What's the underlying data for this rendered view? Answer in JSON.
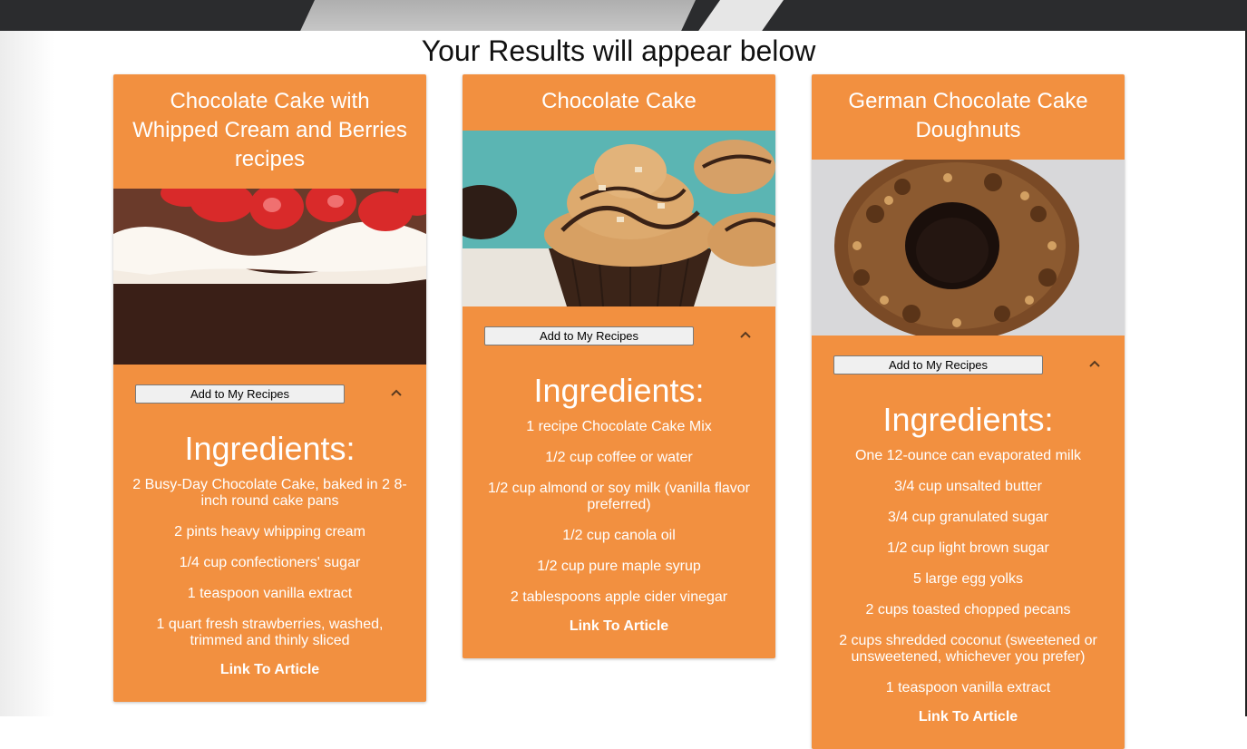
{
  "header": {
    "title": "Your Results will appear below"
  },
  "colors": {
    "card": "#f29040",
    "topbar": "#2b2c2e"
  },
  "cards": [
    {
      "title": "Chocolate Cake with Whipped Cream and Berries recipes",
      "image_alt": "chocolate cake with whipped cream and strawberries",
      "add_label": "Add to My Recipes",
      "ingredients_title": "Ingredients:",
      "ingredients": [
        "2 Busy-Day Chocolate Cake, baked in 2 8-inch round cake pans",
        "2 pints heavy whipping cream",
        "1/4 cup confectioners' sugar",
        "1 teaspoon vanilla extract",
        "1 quart fresh strawberries, washed, trimmed and thinly sliced"
      ],
      "link_label": "Link To Article"
    },
    {
      "title": "Chocolate Cake",
      "image_alt": "chocolate cupcakes with peanut butter frosting",
      "add_label": "Add to My Recipes",
      "ingredients_title": "Ingredients:",
      "ingredients": [
        "1 recipe Chocolate Cake Mix",
        "1/2 cup coffee or water",
        "1/2 cup almond or soy milk (vanilla flavor preferred)",
        "1/2 cup canola oil",
        "1/2 cup pure maple syrup",
        "2 tablespoons apple cider vinegar"
      ],
      "link_label": "Link To Article"
    },
    {
      "title": "German Chocolate Cake Doughnuts",
      "image_alt": "german chocolate doughnut with coconut pecan topping",
      "add_label": "Add to My Recipes",
      "ingredients_title": "Ingredients:",
      "ingredients": [
        "One 12-ounce can evaporated milk",
        "3/4 cup unsalted butter",
        "3/4 cup granulated sugar",
        "1/2 cup light brown sugar",
        "5 large egg yolks",
        "2 cups toasted chopped pecans",
        "2 cups shredded coconut (sweetened or unsweetened, whichever you prefer)",
        "1 teaspoon vanilla extract"
      ],
      "link_label": "Link To Article"
    }
  ]
}
